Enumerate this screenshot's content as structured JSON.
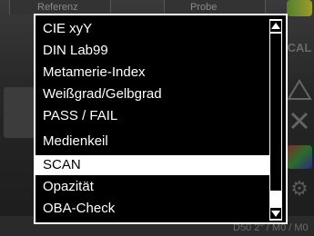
{
  "background": {
    "tabs": [
      "Referenz",
      "Probe"
    ],
    "bottom_text": "D50 2° / M0 / M0"
  },
  "menu": {
    "items": [
      {
        "label": "CIE xyY",
        "selected": false
      },
      {
        "label": "DIN Lab99",
        "selected": false
      },
      {
        "label": "Metamerie-Index",
        "selected": false
      },
      {
        "label": "Weißgrad/Gelbgrad",
        "selected": false
      },
      {
        "label": "PASS / FAIL",
        "selected": false
      },
      {
        "label": "Medienkeil",
        "selected": false
      },
      {
        "label": "SCAN",
        "selected": true
      },
      {
        "label": "Opazität",
        "selected": false
      },
      {
        "label": "OBA-Check",
        "selected": false
      }
    ],
    "scroll_up_icon": "triangle-up",
    "scroll_down_icon": "triangle-down"
  },
  "colors": {
    "menu_bg": "#000000",
    "menu_text": "#ffffff",
    "selection_bg": "#ffffff",
    "selection_text": "#000000"
  }
}
